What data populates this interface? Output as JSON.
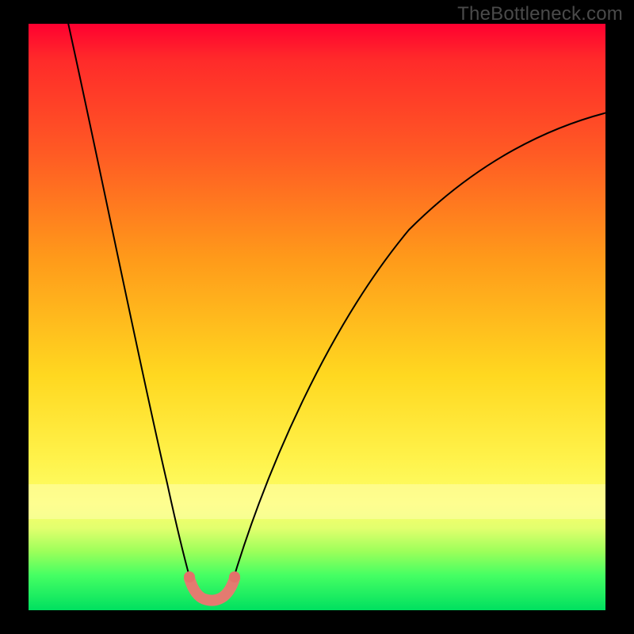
{
  "watermark": "TheBottleneck.com",
  "chart_data": {
    "type": "line",
    "title": "",
    "xlabel": "",
    "ylabel": "",
    "x_range_fraction": [
      0,
      1
    ],
    "y_range_fraction": [
      0,
      1
    ],
    "series": [
      {
        "name": "bottleneck-curve-left",
        "x": [
          0.066,
          0.12,
          0.17,
          0.21,
          0.24,
          0.27,
          0.284
        ],
        "y": [
          0.0,
          0.24,
          0.46,
          0.66,
          0.82,
          0.92,
          0.962
        ]
      },
      {
        "name": "bottleneck-curve-right",
        "x": [
          0.35,
          0.4,
          0.47,
          0.56,
          0.66,
          0.78,
          0.9,
          1.0
        ],
        "y": [
          0.962,
          0.86,
          0.72,
          0.56,
          0.42,
          0.3,
          0.22,
          0.165
        ]
      }
    ],
    "valley_marker": {
      "x_start": 0.279,
      "x_end": 0.357,
      "y": 0.97
    },
    "background_gradient_stops": [
      {
        "pos": 0.0,
        "color": "#ff0030"
      },
      {
        "pos": 0.22,
        "color": "#ff5a24"
      },
      {
        "pos": 0.6,
        "color": "#ffd820"
      },
      {
        "pos": 0.82,
        "color": "#fcff68"
      },
      {
        "pos": 1.0,
        "color": "#00e060"
      }
    ]
  }
}
